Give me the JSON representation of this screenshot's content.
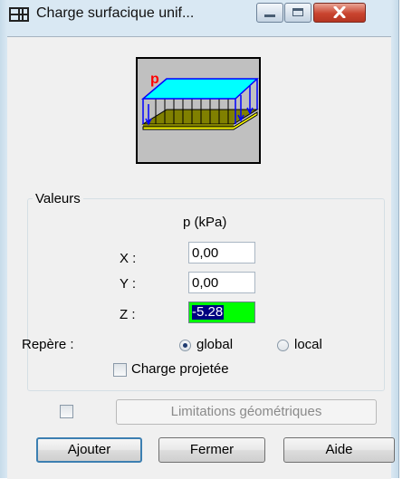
{
  "window": {
    "title": "Charge surfacique unif..."
  },
  "preview": {
    "load_label": "p"
  },
  "values": {
    "group_title": "Valeurs",
    "column_header": "p  (kPa)",
    "fields": [
      {
        "label": "X :",
        "value": "0,00"
      },
      {
        "label": "Y :",
        "value": "0,00"
      },
      {
        "label": "Z :",
        "value": "-5.28"
      }
    ],
    "repere_label": "Repère :",
    "repere_options": [
      {
        "label": "global",
        "selected": true
      },
      {
        "label": "local",
        "selected": false
      }
    ],
    "charge_projetee": {
      "label": "Charge projetée",
      "checked": false
    }
  },
  "limitations": {
    "checked": false,
    "label": "Limitations géométriques"
  },
  "buttons": {
    "add": "Ajouter",
    "close": "Fermer",
    "help": "Aide"
  },
  "colors": {
    "highlight_field": "#00ff00",
    "plate_top": "#00ffff",
    "base": "#ffff00",
    "load_arrows": "#0000ff"
  }
}
